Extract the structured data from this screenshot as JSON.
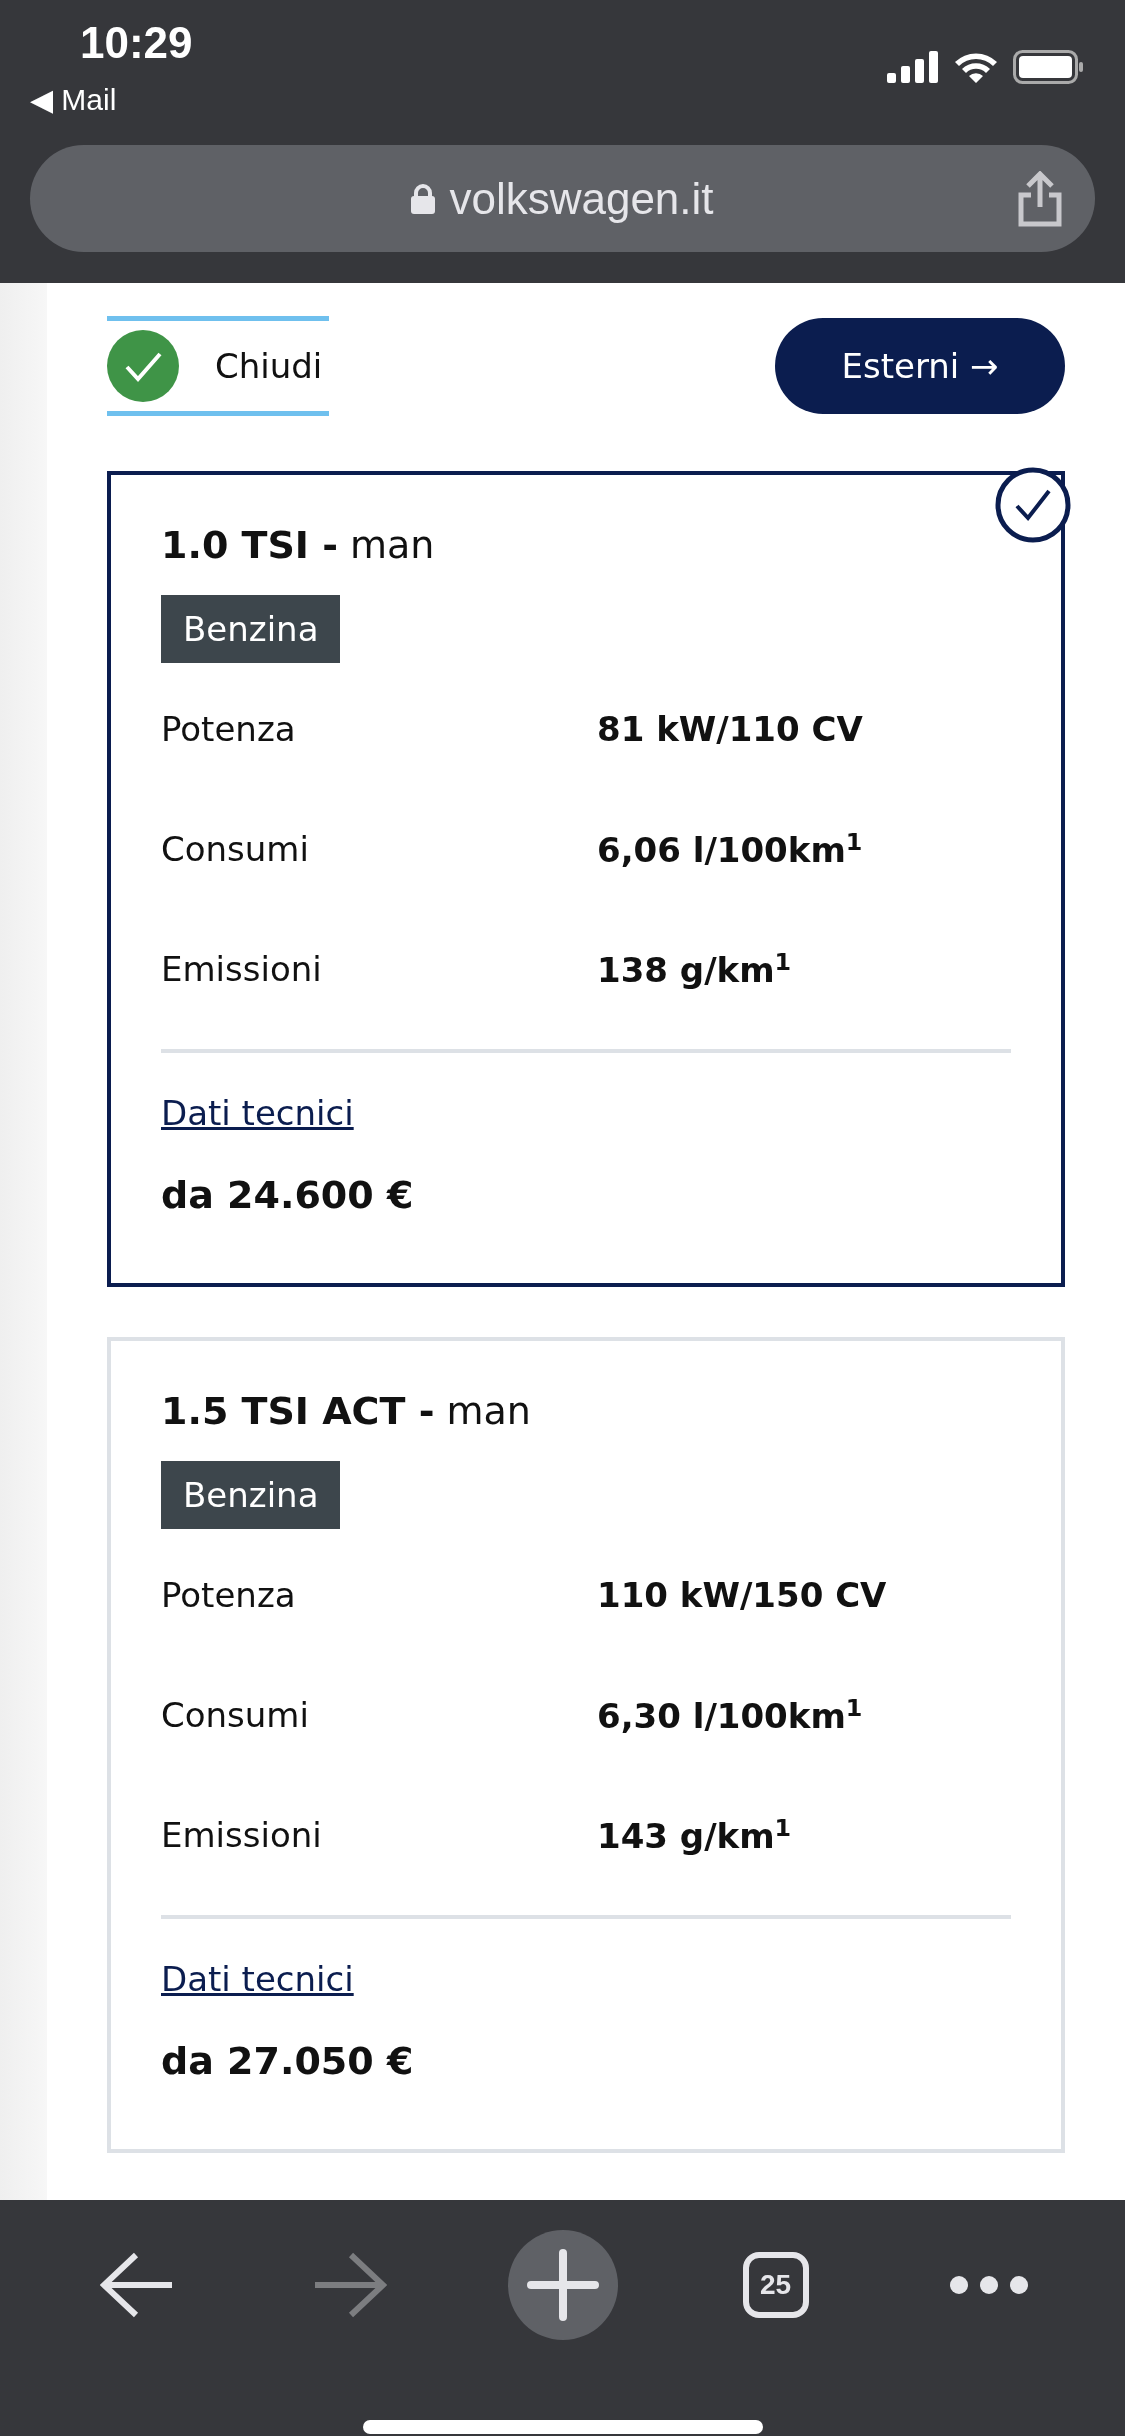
{
  "status_bar": {
    "time": "10:29",
    "back_app": "◀ Mail"
  },
  "address_bar": {
    "url": "volkswagen.it"
  },
  "header": {
    "close_label": "Chiudi",
    "exterior_button": "Esterni →"
  },
  "cards": [
    {
      "title": "**1.0 TSI -** man",
      "selected": true,
      "fuel": "Benzina",
      "specs": [
        {
          "label": "Potenza",
          "value": "81 kW/110 CV"
        },
        {
          "label": "Consumi",
          "value": "6,06 l/100km$^{1}$"
        },
        {
          "label": "Emissioni",
          "value": "138 g/km$^{1}$"
        }
      ],
      "link": "Dati tecnici",
      "price": "da 24.600 €"
    },
    {
      "title": "**1.5 TSI ACT -** man",
      "selected": false,
      "fuel": "Benzina",
      "specs": [
        {
          "label": "Potenza",
          "value": "110 kW/150 CV"
        },
        {
          "label": "Consumi",
          "value": "6,30 l/100km$^{1}$"
        },
        {
          "label": "Emissioni",
          "value": "143 g/km$^{1}$"
        }
      ],
      "link": "Dati tecnici",
      "price": "da 27.050 €"
    }
  ],
  "toolbar": {
    "back_disabled": false,
    "forward_disabled": true,
    "tab_count": "25"
  }
}
